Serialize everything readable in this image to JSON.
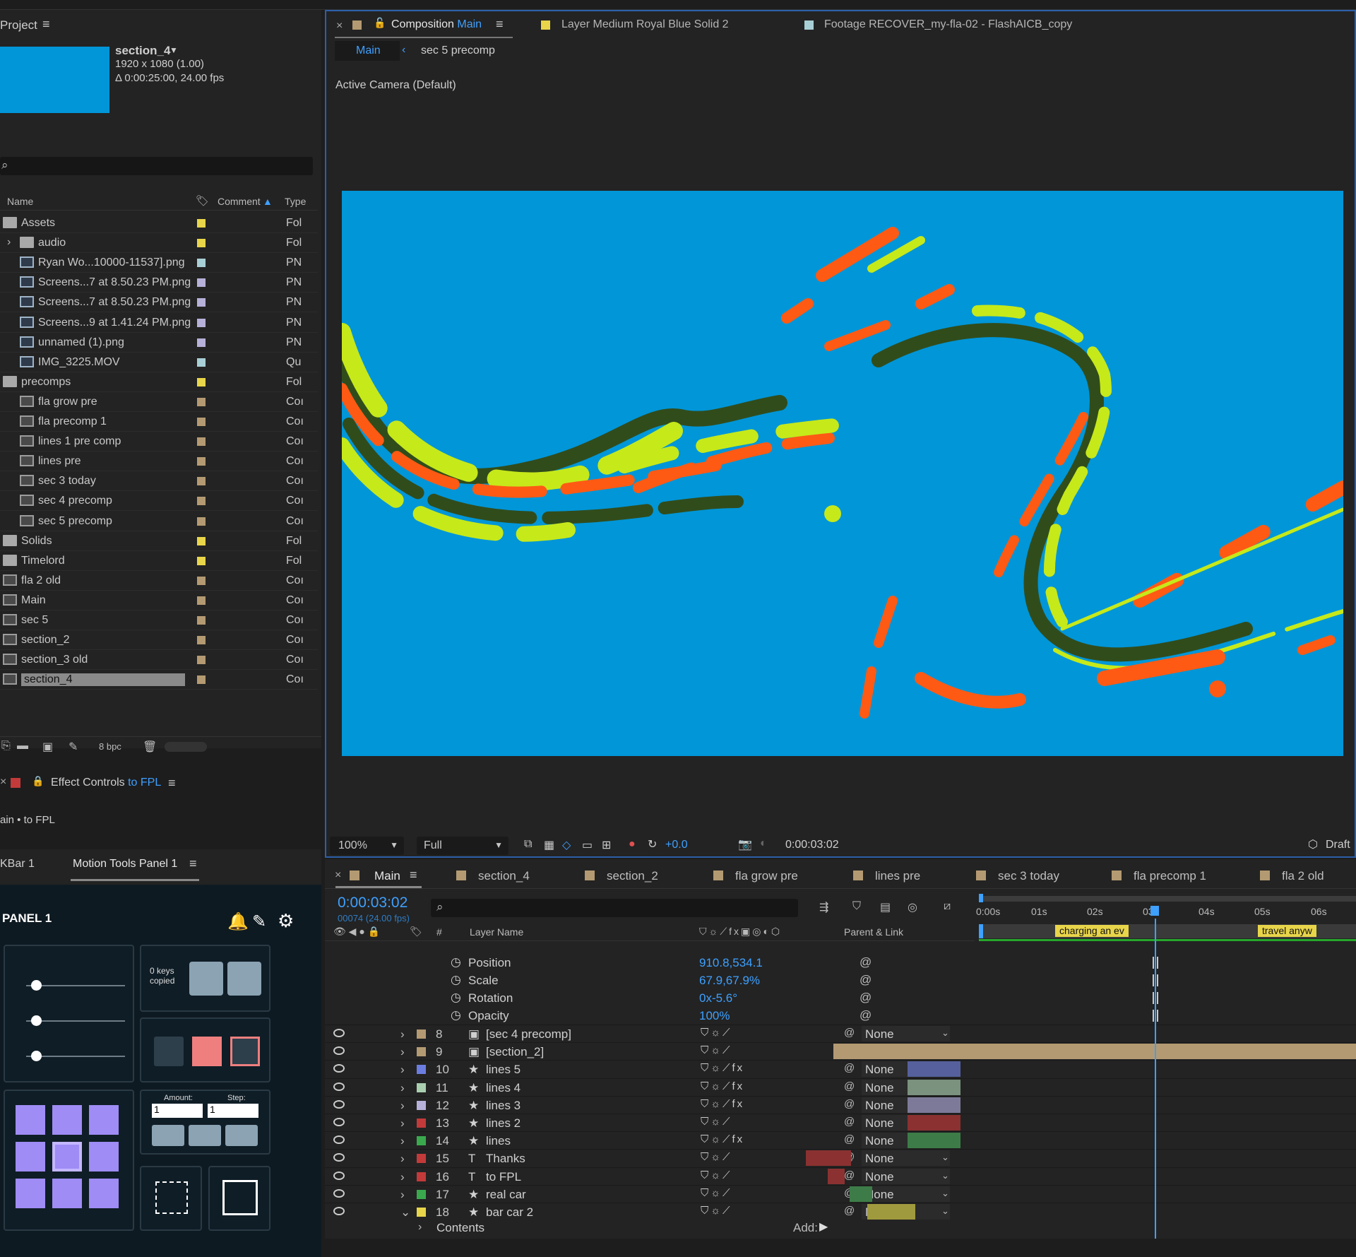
{
  "colors": {
    "accent": "#3ea0ff",
    "comp_bg": "#0096d8",
    "viewer_border": "#2c5fa8",
    "orange": "#ff5a14",
    "lime": "#c6e91a",
    "darkgreen": "#314c1b"
  },
  "project": {
    "title": "Project",
    "comp_name": "section_4",
    "comp_size": "1920 x 1080 (1.00)",
    "comp_duration": "Δ 0:00:25:00, 24.00 fps",
    "columns": {
      "name": "Name",
      "comment": "Comment",
      "type": "Type"
    },
    "bpc": "8 bpc",
    "items": [
      {
        "name": "Assets",
        "type": "Fol",
        "label": "#e8d54a",
        "icon": "folder",
        "indent": 0
      },
      {
        "name": "audio",
        "type": "Fol",
        "label": "#e8d54a",
        "icon": "folder",
        "indent": 1,
        "twirl": "›"
      },
      {
        "name": "Ryan Wo...10000-11537].png",
        "type": "PN",
        "label": "#a9cfd6",
        "icon": "sequence",
        "indent": 1
      },
      {
        "name": "Screens...7 at 8.50.23 PM.png",
        "type": "PN",
        "label": "#b6b1d8",
        "icon": "file",
        "indent": 1
      },
      {
        "name": "Screens...7 at 8.50.23 PM.png",
        "type": "PN",
        "label": "#b6b1d8",
        "icon": "file",
        "indent": 1
      },
      {
        "name": "Screens...9 at 1.41.24 PM.png",
        "type": "PN",
        "label": "#b6b1d8",
        "icon": "file",
        "indent": 1
      },
      {
        "name": "unnamed (1).png",
        "type": "PN",
        "label": "#b6b1d8",
        "icon": "file",
        "indent": 1
      },
      {
        "name": "IMG_3225.MOV",
        "type": "Qu",
        "label": "#a9cfd6",
        "icon": "file",
        "indent": 1
      },
      {
        "name": "precomps",
        "type": "Fol",
        "label": "#e8d54a",
        "icon": "folder",
        "indent": 0
      },
      {
        "name": "fla grow pre",
        "type": "Coı",
        "label": "#b49a72",
        "icon": "comp",
        "indent": 1
      },
      {
        "name": "fla precomp 1",
        "type": "Coı",
        "label": "#b49a72",
        "icon": "comp",
        "indent": 1
      },
      {
        "name": "lines 1 pre comp",
        "type": "Coı",
        "label": "#b49a72",
        "icon": "comp",
        "indent": 1
      },
      {
        "name": "lines pre",
        "type": "Coı",
        "label": "#b49a72",
        "icon": "comp",
        "indent": 1
      },
      {
        "name": "sec 3 today",
        "type": "Coı",
        "label": "#b49a72",
        "icon": "comp",
        "indent": 1
      },
      {
        "name": "sec 4 precomp",
        "type": "Coı",
        "label": "#b49a72",
        "icon": "comp",
        "indent": 1
      },
      {
        "name": "sec 5 precomp",
        "type": "Coı",
        "label": "#b49a72",
        "icon": "comp",
        "indent": 1
      },
      {
        "name": "Solids",
        "type": "Fol",
        "label": "#e8d54a",
        "icon": "folder",
        "indent": 0
      },
      {
        "name": "Timelord",
        "type": "Fol",
        "label": "#e8d54a",
        "icon": "folder",
        "indent": 0
      },
      {
        "name": "fla 2 old",
        "type": "Coı",
        "label": "#b49a72",
        "icon": "comp",
        "indent": 0
      },
      {
        "name": "Main",
        "type": "Coı",
        "label": "#b49a72",
        "icon": "comp",
        "indent": 0
      },
      {
        "name": "sec 5",
        "type": "Coı",
        "label": "#b49a72",
        "icon": "comp",
        "indent": 0
      },
      {
        "name": "section_2",
        "type": "Coı",
        "label": "#b49a72",
        "icon": "comp",
        "indent": 0
      },
      {
        "name": "section_3 old",
        "type": "Coı",
        "label": "#b49a72",
        "icon": "comp",
        "indent": 0
      },
      {
        "name": "section_4",
        "type": "Coı",
        "label": "#b49a72",
        "icon": "comp",
        "indent": 0,
        "selected": true
      }
    ]
  },
  "effect_controls": {
    "title": "Effect Controls",
    "target": "to FPL",
    "breadcrumb": "ain • to FPL"
  },
  "panels": {
    "kbar": "KBar 1",
    "motion_tools": "Motion Tools Panel 1"
  },
  "motion_tools": {
    "title": "PANEL 1",
    "keys_copied": "0 keys\ncopied",
    "amount_label": "Amount:",
    "step_label": "Step:",
    "amount_value": "1",
    "step_value": "1"
  },
  "viewer": {
    "tabs": [
      {
        "prefix": "Composition",
        "name": "Main"
      },
      {
        "prefix": "Layer",
        "name": "Medium Royal Blue Solid 2"
      },
      {
        "prefix": "Footage",
        "name": "RECOVER_my-fla-02 - FlashAICB_copy"
      }
    ],
    "breadcrumb": [
      "Main",
      "sec 5 precomp"
    ],
    "camera": "Active Camera (Default)",
    "zoom": "100%",
    "resolution": "Full",
    "exposure": "+0.0",
    "timecode": "0:00:03:02",
    "renderer": "Draft"
  },
  "timeline": {
    "tabs": [
      "Main",
      "section_4",
      "section_2",
      "fla grow pre",
      "lines pre",
      "sec 3 today",
      "fla precomp 1",
      "fla 2 old"
    ],
    "timecode": "0:00:03:02",
    "frame": "00074 (24.00 fps)",
    "col_layer_name": "Layer Name",
    "col_parent": "Parent & Link",
    "ruler": [
      "0:00s",
      "01s",
      "02s",
      "03s",
      "04s",
      "05s",
      "06s"
    ],
    "markers": [
      "charging an ev",
      "travel anyw"
    ],
    "properties": [
      {
        "name": "Position",
        "value": "910.8,534.1"
      },
      {
        "name": "Scale",
        "value": "67.9,67.9%"
      },
      {
        "name": "Rotation",
        "value": "0x-5.6°"
      },
      {
        "name": "Opacity",
        "value": "100%"
      }
    ],
    "layers": [
      {
        "num": "8",
        "name": "[sec 4 precomp]",
        "color": "#b49a72",
        "icon": "comp",
        "parent": "None",
        "bar_color": "#b49a72"
      },
      {
        "num": "9",
        "name": "[section_2]",
        "color": "#b49a72",
        "icon": "comp",
        "parent": "None",
        "bar_color": "#b49a72"
      },
      {
        "num": "10",
        "name": "lines 5",
        "color": "#6b7de0",
        "icon": "star",
        "parent": "None",
        "bar_color": "#55609c",
        "fx": true
      },
      {
        "num": "11",
        "name": "lines 4",
        "color": "#a9cfb0",
        "icon": "star",
        "parent": "None",
        "bar_color": "#7b927e",
        "fx": true
      },
      {
        "num": "12",
        "name": "lines 3",
        "color": "#b6b1d8",
        "icon": "star",
        "parent": "None",
        "bar_color": "#7d7a99",
        "fx": true
      },
      {
        "num": "13",
        "name": "lines 2",
        "color": "#c33a3a",
        "icon": "star",
        "parent": "None",
        "bar_color": "#8b3131"
      },
      {
        "num": "14",
        "name": "lines",
        "color": "#3aa94e",
        "icon": "star",
        "parent": "None",
        "bar_color": "#3d7c48",
        "fx": true
      },
      {
        "num": "15",
        "name": "Thanks",
        "color": "#c33a3a",
        "icon": "T",
        "parent": "None",
        "bar_color": "#8b3131"
      },
      {
        "num": "16",
        "name": "to FPL",
        "color": "#c33a3a",
        "icon": "T",
        "parent": "None",
        "bar_color": "#8b3131"
      },
      {
        "num": "17",
        "name": "real car",
        "color": "#3aa94e",
        "icon": "star",
        "parent": "None",
        "bar_color": "#3d7c48"
      },
      {
        "num": "18",
        "name": "bar car 2",
        "color": "#e8d54a",
        "icon": "star",
        "parent": "None",
        "bar_color": "#a09a3e"
      }
    ],
    "contents": "Contents",
    "add": "Add:"
  }
}
